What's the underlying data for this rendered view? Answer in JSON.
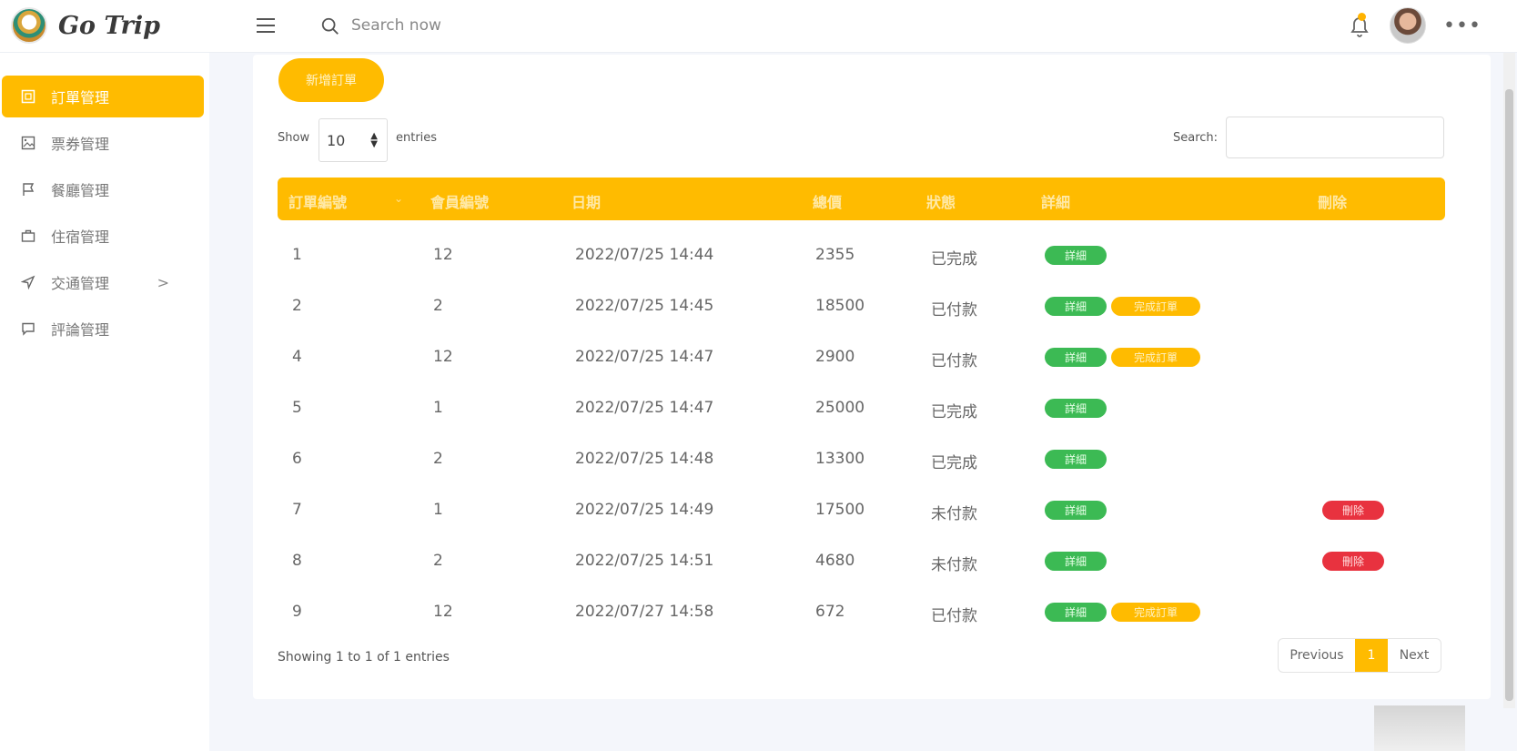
{
  "app": {
    "name": "Go Trip"
  },
  "header": {
    "search_placeholder": "Search now",
    "more_label": "•••"
  },
  "sidebar": {
    "items": [
      {
        "label": "訂單管理",
        "icon": "order-icon",
        "active": true
      },
      {
        "label": "票券管理",
        "icon": "image-icon",
        "active": false
      },
      {
        "label": "餐廳管理",
        "icon": "flag-icon",
        "active": false
      },
      {
        "label": "住宿管理",
        "icon": "briefcase-icon",
        "active": false
      },
      {
        "label": "交通管理",
        "icon": "send-icon",
        "active": false,
        "has_submenu": true
      },
      {
        "label": "評論管理",
        "icon": "message-icon",
        "active": false
      }
    ],
    "submenu_arrow": ">"
  },
  "toolbar": {
    "add_order_label": "新增訂單",
    "show_label": "Show",
    "page_size": "10",
    "entries_label": "entries",
    "search_label": "Search:"
  },
  "table": {
    "columns": [
      "訂單編號",
      "會員編號",
      "日期",
      "總價",
      "狀態",
      "詳細",
      "刪除"
    ],
    "rows": [
      {
        "id": "1",
        "member": "12",
        "date": "2022/07/25 14:44",
        "total": "2355",
        "status": "已完成",
        "detail": "詳細",
        "action": "",
        "delete": ""
      },
      {
        "id": "2",
        "member": "2",
        "date": "2022/07/25 14:45",
        "total": "18500",
        "status": "已付款",
        "detail": "詳細",
        "action": "完成訂單",
        "delete": ""
      },
      {
        "id": "4",
        "member": "12",
        "date": "2022/07/25 14:47",
        "total": "2900",
        "status": "已付款",
        "detail": "詳細",
        "action": "完成訂單",
        "delete": ""
      },
      {
        "id": "5",
        "member": "1",
        "date": "2022/07/25 14:47",
        "total": "25000",
        "status": "已完成",
        "detail": "詳細",
        "action": "",
        "delete": ""
      },
      {
        "id": "6",
        "member": "2",
        "date": "2022/07/25 14:48",
        "total": "13300",
        "status": "已完成",
        "detail": "詳細",
        "action": "",
        "delete": ""
      },
      {
        "id": "7",
        "member": "1",
        "date": "2022/07/25 14:49",
        "total": "17500",
        "status": "未付款",
        "detail": "詳細",
        "action": "",
        "delete": "刪除"
      },
      {
        "id": "8",
        "member": "2",
        "date": "2022/07/25 14:51",
        "total": "4680",
        "status": "未付款",
        "detail": "詳細",
        "action": "",
        "delete": "刪除"
      },
      {
        "id": "9",
        "member": "12",
        "date": "2022/07/27 14:58",
        "total": "672",
        "status": "已付款",
        "detail": "詳細",
        "action": "完成訂單",
        "delete": ""
      }
    ]
  },
  "footer": {
    "showing_text": "Showing 1 to 1 of 1 entries",
    "prev_label": "Previous",
    "current_page": "1",
    "next_label": "Next"
  },
  "colors": {
    "accent": "#ffbb00",
    "success": "#3cba54",
    "danger": "#e8323f"
  }
}
